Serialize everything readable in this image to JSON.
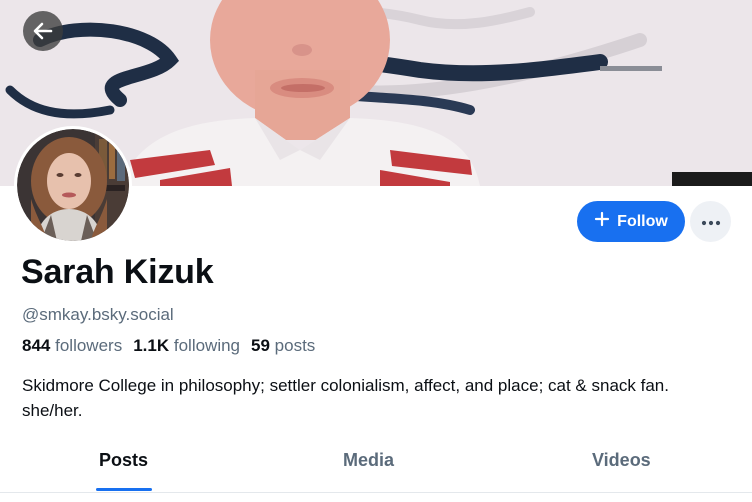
{
  "profile": {
    "display_name": "Sarah Kizuk",
    "handle": "@smkay.bsky.social",
    "bio": "Skidmore College in philosophy; settler colonialism, affect, and place; cat & snack fan. she/her."
  },
  "stats": {
    "followers_count": "844",
    "followers_label": "followers",
    "following_count": "1.1K",
    "following_label": "following",
    "posts_count": "59",
    "posts_label": "posts"
  },
  "actions": {
    "follow_label": "Follow"
  },
  "tabs": [
    {
      "label": "Posts",
      "active": true
    },
    {
      "label": "Media",
      "active": false
    },
    {
      "label": "Videos",
      "active": false
    }
  ],
  "icons": {
    "back": "arrow-left-icon",
    "follow": "plus-icon",
    "more": "ellipsis-icon"
  },
  "colors": {
    "accent": "#1870f0",
    "text_primary": "#0b0f14",
    "text_secondary": "#5b6b7b",
    "divider": "#e4e8ec"
  }
}
